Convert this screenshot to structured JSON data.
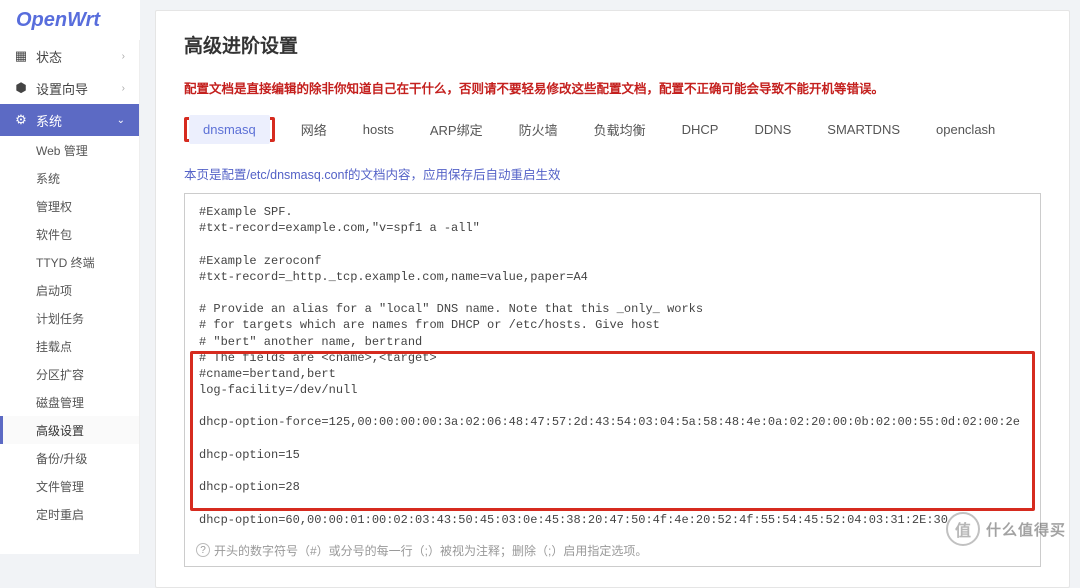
{
  "brand": "OpenWrt",
  "nav": {
    "status": "状态",
    "wizard": "设置向导",
    "system": "系统",
    "sub": [
      "Web 管理",
      "系统",
      "管理权",
      "软件包",
      "TTYD 终端",
      "启动项",
      "计划任务",
      "挂载点",
      "分区扩容",
      "磁盘管理",
      "高级设置",
      "备份/升级",
      "文件管理",
      "定时重启",
      ""
    ]
  },
  "page": {
    "title": "高级进阶设置",
    "warn": "配置文档是直接编辑的除非你知道自己在干什么，否则请不要轻易修改这些配置文档，配置不正确可能会导致不能开机等错误。",
    "tabs": [
      "dnsmasq",
      "网络",
      "hosts",
      "ARP绑定",
      "防火墙",
      "负载均衡",
      "DHCP",
      "DDNS",
      "SMARTDNS",
      "openclash"
    ],
    "desc": "本页是配置/etc/dnsmasq.conf的文档内容，应用保存后自动重启生效",
    "config": "#Example SPF.\n#txt-record=example.com,\"v=spf1 a -all\"\n\n#Example zeroconf\n#txt-record=_http._tcp.example.com,name=value,paper=A4\n\n# Provide an alias for a \"local\" DNS name. Note that this _only_ works\n# for targets which are names from DHCP or /etc/hosts. Give host\n# \"bert\" another name, bertrand\n# The fields are <cname>,<target>\n#cname=bertand,bert\nlog-facility=/dev/null\n\ndhcp-option-force=125,00:00:00:00:3a:02:06:48:47:57:2d:43:54:03:04:5a:58:48:4e:0a:02:20:00:0b:02:00:55:0d:02:00:2e\n\ndhcp-option=15\n\ndhcp-option=28\n\ndhcp-option=60,00:00:01:00:02:03:43:50:45:03:0e:45:38:20:47:50:4f:4e:20:52:4f:55:54:45:52:04:03:31:2E:30",
    "hint": "开头的数字符号（#）或分号的每一行（;）被视为注释；删除（;）启用指定选项。"
  },
  "watermark": {
    "badge": "值",
    "text": "什么值得买"
  }
}
